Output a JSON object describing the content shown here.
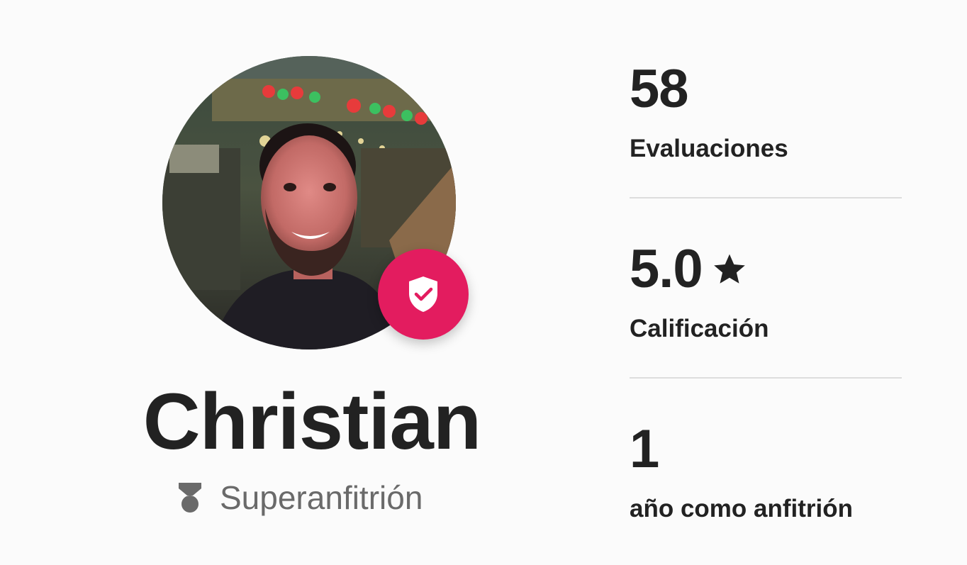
{
  "profile": {
    "name": "Christian",
    "superhost_label": "Superanfitrión",
    "avatar_alt": "Christian",
    "verified_icon": "shield-check-icon",
    "superhost_icon": "superhost-medal-icon"
  },
  "stats": [
    {
      "value": "58",
      "label": "Evaluaciones"
    },
    {
      "value": "5.0",
      "label": "Calificación",
      "icon": "star-icon"
    },
    {
      "value": "1",
      "label": "año como anfitrión"
    }
  ],
  "colors": {
    "accent": "#e31c5f",
    "text": "#222222",
    "muted": "#6a6a6a",
    "divider": "#dddddd"
  }
}
